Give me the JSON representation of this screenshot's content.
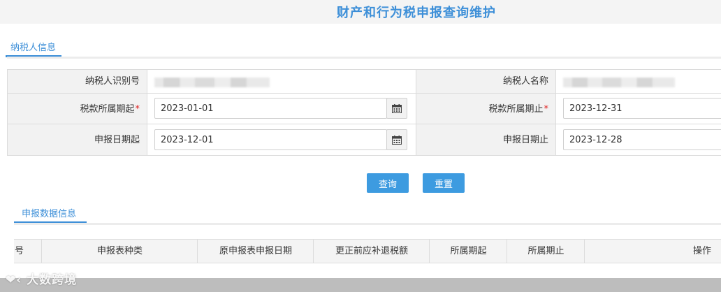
{
  "page": {
    "title": "财产和行为税申报查询维护"
  },
  "tabs": {
    "taxpayer": "纳税人信息",
    "declaration": "申报数据信息"
  },
  "form": {
    "taxpayer_id_label": "纳税人识别号",
    "taxpayer_name_label": "纳税人名称",
    "period_start_label": "税款所属期起",
    "period_end_label": "税款所属期止",
    "decl_start_label": "申报日期起",
    "decl_end_label": "申报日期止",
    "required_mark": "*",
    "period_start_value": "2023-01-01",
    "period_end_value": "2023-12-31",
    "decl_start_value": "2023-12-01",
    "decl_end_value": "2023-12-28"
  },
  "buttons": {
    "query": "查询",
    "reset": "重置"
  },
  "grid": {
    "columns": [
      "号",
      "申报表种类",
      "原申报表申报日期",
      "更正前应补退税额",
      "所属期起",
      "所属期止",
      "操作"
    ]
  },
  "watermark": {
    "text": "大数跨境"
  },
  "icons": {
    "calendar": "calendar-icon"
  }
}
